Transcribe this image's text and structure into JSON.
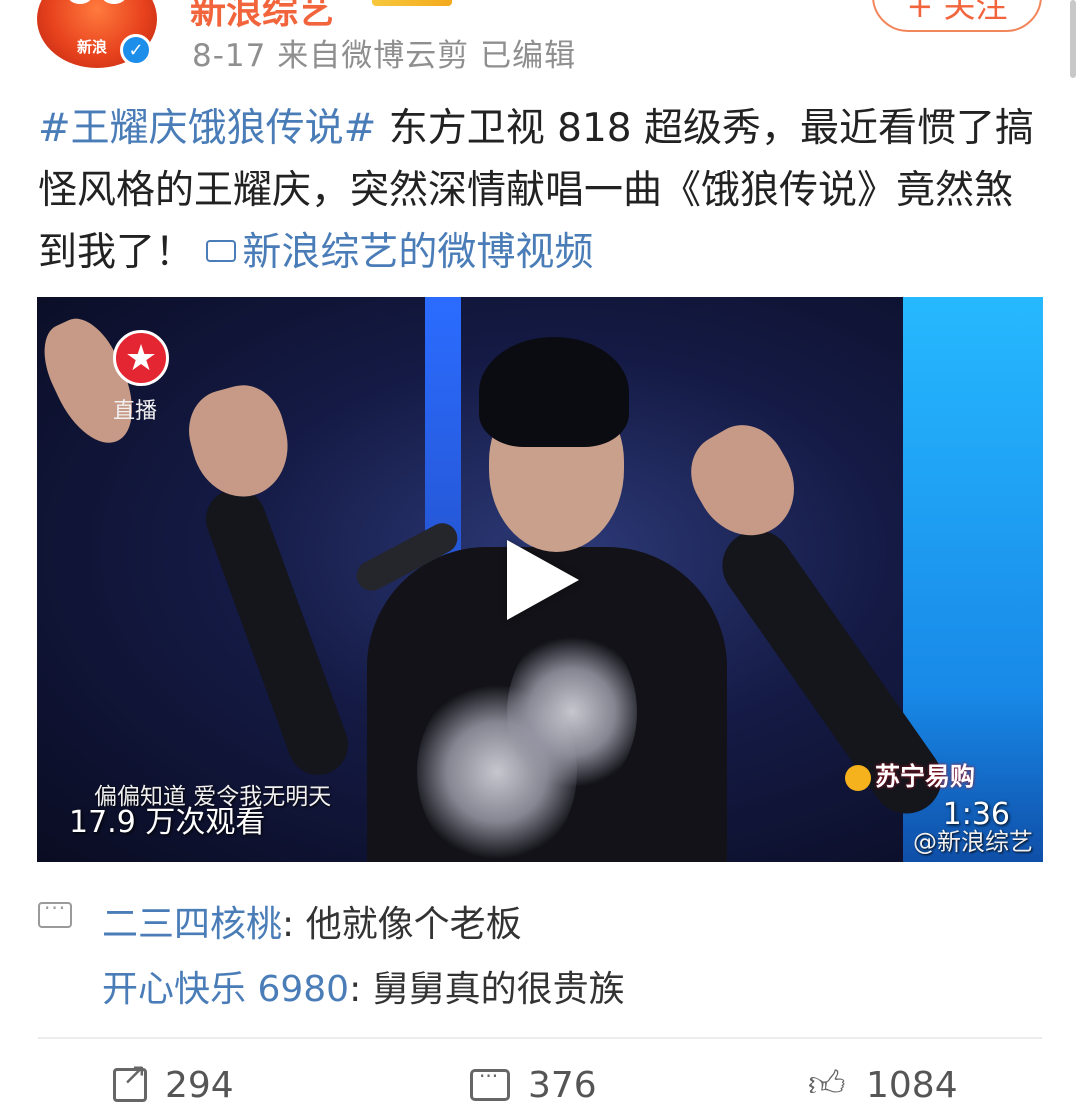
{
  "header": {
    "username": "新浪综艺",
    "avatar_text": "新浪",
    "meta": "8-17  来自微博云剪  已编辑",
    "follow_label": "+ 关注"
  },
  "post": {
    "hashtag": "#王耀庆饿狼传说#",
    "body": " 东方卫视 818 超级秀，最近看惯了搞怪风格的王耀庆，突然深情献唱一曲《饿狼传说》竟然煞到我了！",
    "video_link": "新浪综艺的微博视频"
  },
  "video": {
    "station_label": "直播",
    "sponsor": "苏宁易购",
    "lyric": "偏偏知道 爱令我无明天",
    "views": "17.9 万次观看",
    "duration": "1:36",
    "watermark": "@新浪综艺"
  },
  "comments": [
    {
      "user": "二三四核桃",
      "text": ": 他就像个老板"
    },
    {
      "user": "开心快乐 6980",
      "text": ": 舅舅真的很贵族"
    }
  ],
  "actions": {
    "share_count": "294",
    "comment_count": "376",
    "like_count": "1084"
  },
  "colors": {
    "link_blue": "#4a7db8",
    "brand_orange": "#f2643c"
  }
}
